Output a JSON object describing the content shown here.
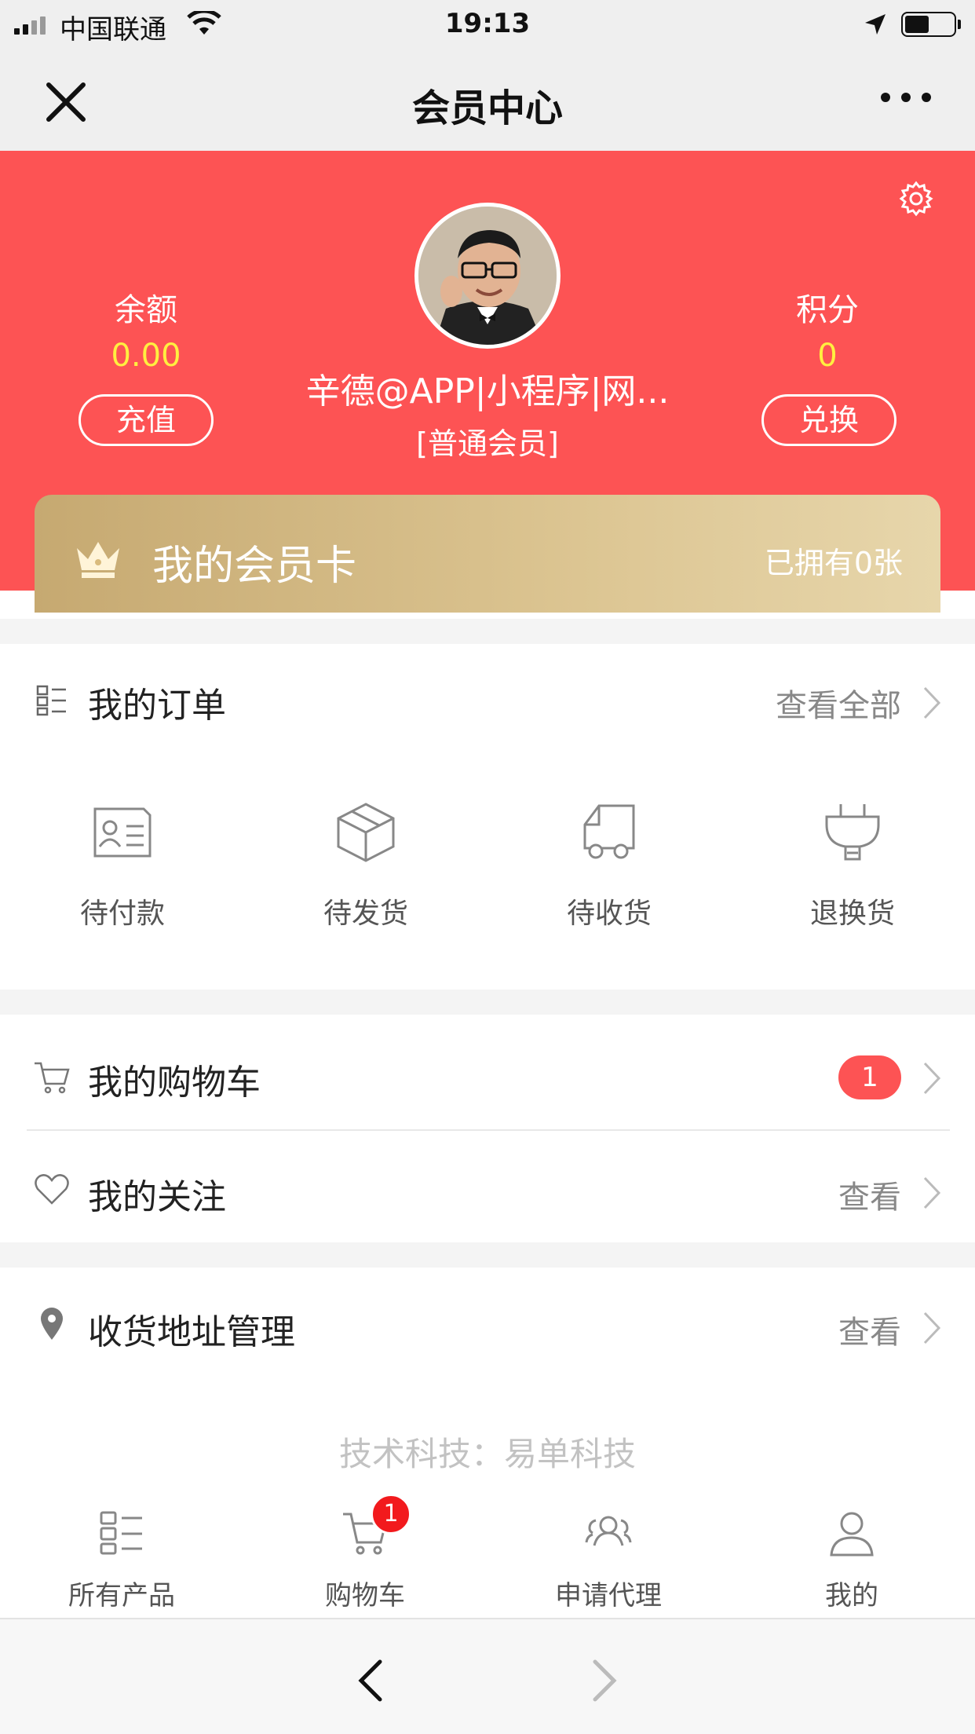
{
  "status_bar": {
    "carrier": "中国联通",
    "time": "19:13"
  },
  "nav": {
    "title": "会员中心"
  },
  "header": {
    "balance_label": "余额",
    "balance_value": "0.00",
    "recharge_label": "充值",
    "points_label": "积分",
    "points_value": "0",
    "exchange_label": "兑换",
    "username": "辛德@APP|小程序|网...",
    "member_level": "[普通会员]",
    "card_title": "我的会员卡",
    "card_count": "已拥有0张"
  },
  "orders": {
    "title": "我的订单",
    "view_all": "查看全部",
    "items": [
      {
        "label": "待付款",
        "icon": "id-card-icon"
      },
      {
        "label": "待发货",
        "icon": "box-icon"
      },
      {
        "label": "待收货",
        "icon": "truck-icon"
      },
      {
        "label": "退换货",
        "icon": "plug-icon"
      }
    ]
  },
  "cart": {
    "title": "我的购物车",
    "badge": "1"
  },
  "favorites": {
    "title": "我的关注",
    "action": "查看"
  },
  "address": {
    "title": "收货地址管理",
    "action": "查看"
  },
  "footer": {
    "text": "技术科技：易单科技"
  },
  "tabbar": {
    "items": [
      {
        "label": "所有产品",
        "icon": "grid-list-icon"
      },
      {
        "label": "购物车",
        "icon": "cart-icon"
      },
      {
        "label": "申请代理",
        "icon": "group-icon"
      },
      {
        "label": "我的",
        "icon": "person-icon"
      }
    ],
    "cart_badge": "1"
  },
  "colors": {
    "accent": "#fd5354",
    "gold": "#dcc592",
    "yellow": "#ffef40"
  }
}
